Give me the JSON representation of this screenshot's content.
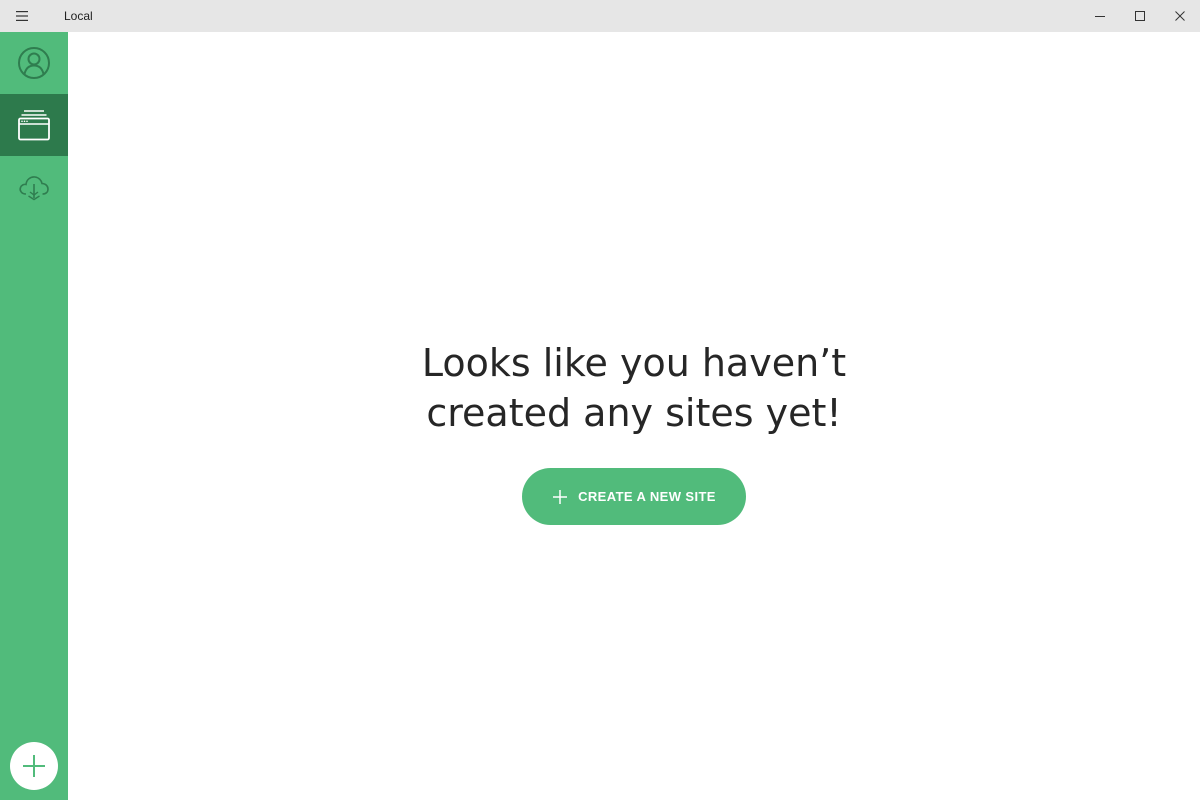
{
  "window": {
    "title": "Local",
    "menu_icon": "hamburger-menu-icon",
    "controls": [
      "minimize-icon",
      "maximize-icon",
      "close-icon"
    ]
  },
  "sidebar": {
    "items": [
      {
        "icon": "user-account-icon",
        "active": false
      },
      {
        "icon": "sites-browser-icon",
        "active": true
      },
      {
        "icon": "cloud-connect-icon",
        "active": false
      }
    ],
    "add_button_icon": "plus-icon"
  },
  "main": {
    "empty_state": {
      "title_line1": "Looks like you haven’t",
      "title_line2": "created any sites yet!",
      "cta_label": "CREATE A NEW SITE",
      "cta_icon": "plus-icon"
    }
  },
  "colors": {
    "brand_green": "#51bb7b",
    "active_green": "#2d7a4c",
    "icon_dark_green": "#2f7d4f",
    "titlebar_bg": "#e6e6e6",
    "text_dark": "#262626"
  }
}
